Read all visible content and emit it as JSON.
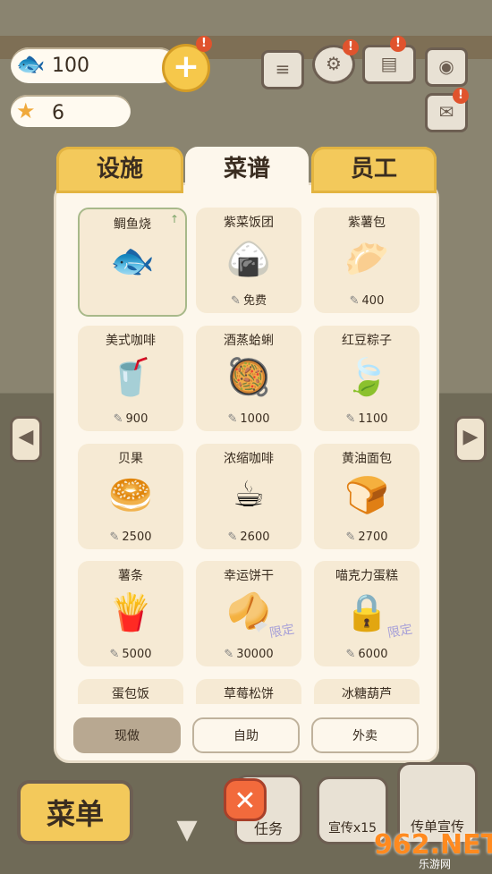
{
  "hud": {
    "fish_count": "100",
    "star_count": "6",
    "fish_icon": "fish-icon",
    "star_icon": "star-icon",
    "plus_label": "+",
    "notif_mark": "!"
  },
  "tabs": [
    {
      "label": "设施",
      "active": false
    },
    {
      "label": "菜谱",
      "active": true
    },
    {
      "label": "员工",
      "active": false
    }
  ],
  "recipes": [
    {
      "name": "鲷鱼烧",
      "icon": "taiyaki-icon",
      "price": "",
      "selected": true
    },
    {
      "name": "紫菜饭团",
      "icon": "onigiri-icon",
      "price": "免费"
    },
    {
      "name": "紫薯包",
      "icon": "purple-bun-icon",
      "price": "400"
    },
    {
      "name": "美式咖啡",
      "icon": "iced-coffee-icon",
      "price": "900"
    },
    {
      "name": "酒蒸蛤蜊",
      "icon": "clams-icon",
      "price": "1000"
    },
    {
      "name": "红豆粽子",
      "icon": "zongzi-icon",
      "price": "1100"
    },
    {
      "name": "贝果",
      "icon": "bagel-icon",
      "price": "2500"
    },
    {
      "name": "浓缩咖啡",
      "icon": "espresso-icon",
      "price": "2600"
    },
    {
      "name": "黄油面包",
      "icon": "butter-bread-icon",
      "price": "2700"
    },
    {
      "name": "薯条",
      "icon": "fries-icon",
      "price": "5000"
    },
    {
      "name": "幸运饼干",
      "icon": "fortune-cookie-icon",
      "price": "30000",
      "limited": "限定"
    },
    {
      "name": "喵克力蛋糕",
      "icon": "locked-cake-icon",
      "price": "6000",
      "limited": "限定"
    },
    {
      "name": "蛋包饭",
      "icon": "",
      "price": ""
    },
    {
      "name": "草莓松饼",
      "icon": "",
      "price": ""
    },
    {
      "name": "冰糖葫芦",
      "icon": "",
      "price": ""
    }
  ],
  "modes": [
    {
      "label": "现做",
      "active": true
    },
    {
      "label": "自助",
      "active": false
    },
    {
      "label": "外卖",
      "active": false
    }
  ],
  "bottom": {
    "menu_label": "菜单",
    "task_label": "任务",
    "promo_label": "宣传x15",
    "flyer_label": "传单宣传",
    "close_label": "✕"
  },
  "watermark": {
    "logo": "962.NET",
    "sub": "乐游网"
  }
}
